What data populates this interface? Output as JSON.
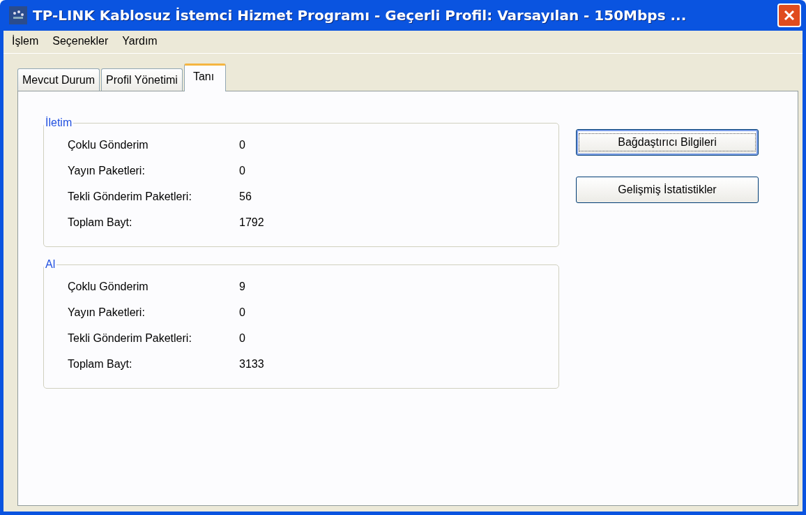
{
  "window": {
    "title": "TP-LINK Kablosuz İstemci Hizmet Programı - Geçerli Profil: Varsayılan - 150Mbps ..."
  },
  "menu": [
    "İşlem",
    "Seçenekler",
    "Yardım"
  ],
  "tabs": [
    {
      "label": "Mevcut Durum",
      "selected": false
    },
    {
      "label": "Profil Yönetimi",
      "selected": false
    },
    {
      "label": "Tanı",
      "selected": true
    }
  ],
  "groups": [
    {
      "title": "İletim",
      "rows": [
        {
          "label": "Çoklu Gönderim",
          "value": "0"
        },
        {
          "label": "Yayın Paketleri:",
          "value": "0"
        },
        {
          "label": "Tekli Gönderim Paketleri:",
          "value": "56"
        },
        {
          "label": "Toplam Bayt:",
          "value": "1792"
        }
      ]
    },
    {
      "title": "Al",
      "rows": [
        {
          "label": "Çoklu Gönderim",
          "value": "9"
        },
        {
          "label": "Yayın Paketleri:",
          "value": "0"
        },
        {
          "label": "Tekli Gönderim Paketleri:",
          "value": "0"
        },
        {
          "label": "Toplam Bayt:",
          "value": "3133"
        }
      ]
    }
  ],
  "buttons": [
    {
      "label": "Bağdaştırıcı Bilgileri",
      "focused": true
    },
    {
      "label": "Gelişmiş İstatistikler",
      "focused": false
    }
  ]
}
